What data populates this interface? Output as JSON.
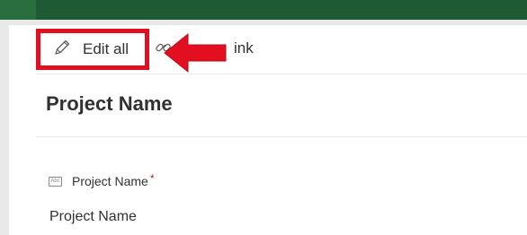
{
  "toolbar": {
    "edit_all_label": "Edit all",
    "link_label": "ink",
    "edit_icon": "pencil-icon",
    "link_icon": "link-icon"
  },
  "annotation": {
    "highlight_color": "#e10f1f",
    "arrow_color": "#e10f1f"
  },
  "form": {
    "title": "Project Name",
    "field": {
      "icon": "text-field-icon",
      "icon_text": "Abc",
      "label": "Project Name",
      "required_marker": "*",
      "value": "Project Name"
    }
  },
  "colors": {
    "top_bar": "#1e5a33",
    "text": "#323130",
    "divider": "#edebe9"
  }
}
